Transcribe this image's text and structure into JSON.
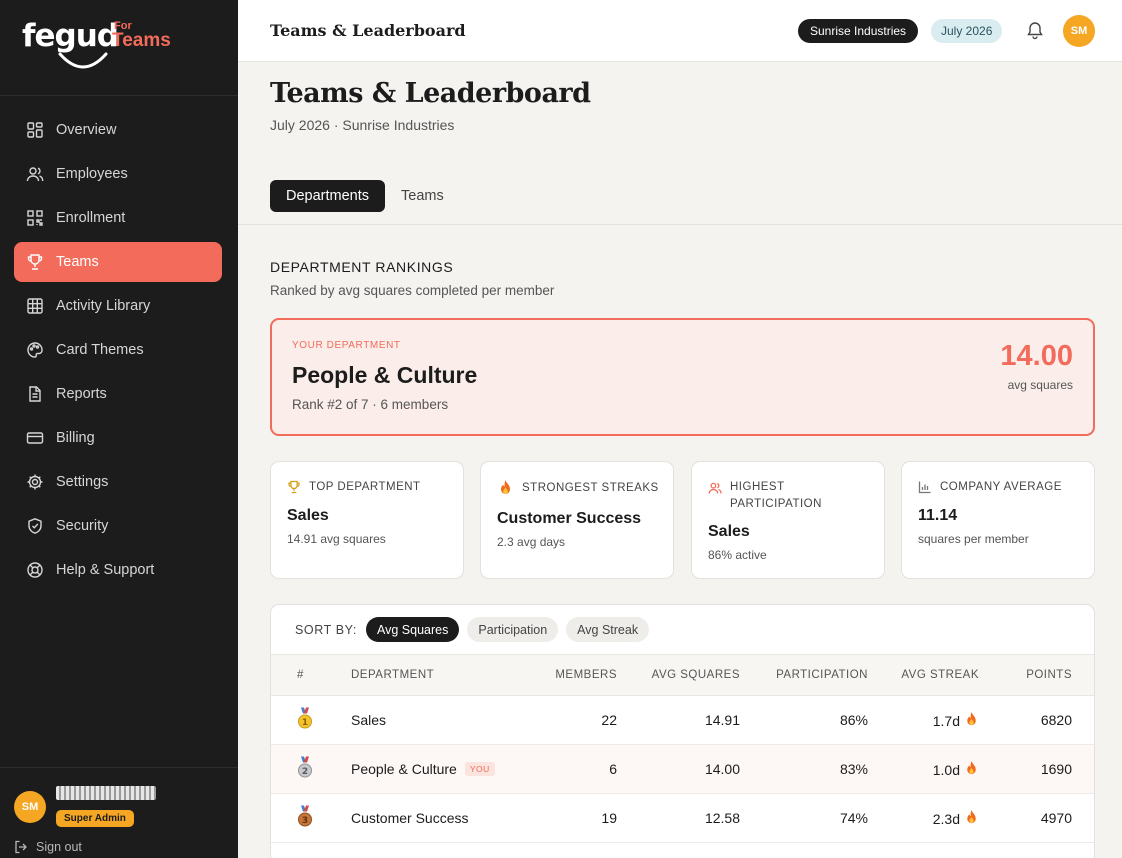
{
  "brand": {
    "name": "fegud",
    "for": "For",
    "product": "Teams"
  },
  "sidebar": {
    "items": [
      {
        "label": "Overview",
        "icon": "grid-icon"
      },
      {
        "label": "Employees",
        "icon": "users-icon"
      },
      {
        "label": "Enrollment",
        "icon": "qr-code-icon"
      },
      {
        "label": "Teams",
        "icon": "trophy-icon",
        "active": true
      },
      {
        "label": "Activity Library",
        "icon": "table-grid-icon"
      },
      {
        "label": "Card Themes",
        "icon": "palette-icon"
      },
      {
        "label": "Reports",
        "icon": "document-icon"
      },
      {
        "label": "Billing",
        "icon": "credit-card-icon"
      },
      {
        "label": "Settings",
        "icon": "gear-icon"
      },
      {
        "label": "Security",
        "icon": "shield-icon"
      },
      {
        "label": "Help & Support",
        "icon": "lifebuoy-icon"
      }
    ],
    "user": {
      "initials": "SM",
      "role": "Super Admin"
    },
    "signout": "Sign out"
  },
  "topbar": {
    "title": "Teams & Leaderboard",
    "company": "Sunrise Industries",
    "month": "July 2026",
    "initials": "SM"
  },
  "page": {
    "title": "Teams & Leaderboard",
    "subtitle": "July 2026 · Sunrise Industries"
  },
  "tabs": [
    "Departments",
    "Teams"
  ],
  "rankings": {
    "title": "DEPARTMENT RANKINGS",
    "subtitle": "Ranked by avg squares completed per member"
  },
  "your_department": {
    "label": "YOUR DEPARTMENT",
    "name": "People & Culture",
    "rank_line": "Rank #2 of 7 · 6 members",
    "score": "14.00",
    "unit": "avg squares"
  },
  "stats": [
    {
      "label": "TOP DEPARTMENT",
      "value": "Sales",
      "note": "14.91 avg squares",
      "icon": "trophy-icon"
    },
    {
      "label": "STRONGEST STREAKS",
      "value": "Customer Success",
      "note": "2.3 avg days",
      "icon": "flame-icon"
    },
    {
      "label": "HIGHEST PARTICIPATION",
      "value": "Sales",
      "note": "86% active",
      "icon": "users-icon"
    },
    {
      "label": "COMPANY AVERAGE",
      "value": "11.14",
      "note": "squares per member",
      "icon": "bar-chart-icon"
    }
  ],
  "sort": {
    "label": "SORT BY:",
    "options": [
      "Avg Squares",
      "Participation",
      "Avg Streak"
    ],
    "active": "Avg Squares"
  },
  "table": {
    "columns": [
      "#",
      "DEPARTMENT",
      "MEMBERS",
      "AVG SQUARES",
      "PARTICIPATION",
      "AVG STREAK",
      "POINTS"
    ],
    "you_tag": "YOU",
    "rows": [
      {
        "medal": "gold-medal-icon",
        "department": "Sales",
        "members": "22",
        "avg_squares": "14.91",
        "participation": "86%",
        "avg_streak": "1.7d",
        "points": "6820"
      },
      {
        "medal": "silver-medal-icon",
        "department": "People & Culture",
        "members": "6",
        "avg_squares": "14.00",
        "participation": "83%",
        "avg_streak": "1.0d",
        "points": "1690",
        "you": true
      },
      {
        "medal": "bronze-medal-icon",
        "department": "Customer Success",
        "members": "19",
        "avg_squares": "12.58",
        "participation": "74%",
        "avg_streak": "2.3d",
        "points": "4970"
      }
    ]
  },
  "colors": {
    "accent": "#f26b5b",
    "sidebar_bg": "#1c1c1c",
    "avatar": "#f5a623",
    "month_pill": "#d9ecf0"
  }
}
